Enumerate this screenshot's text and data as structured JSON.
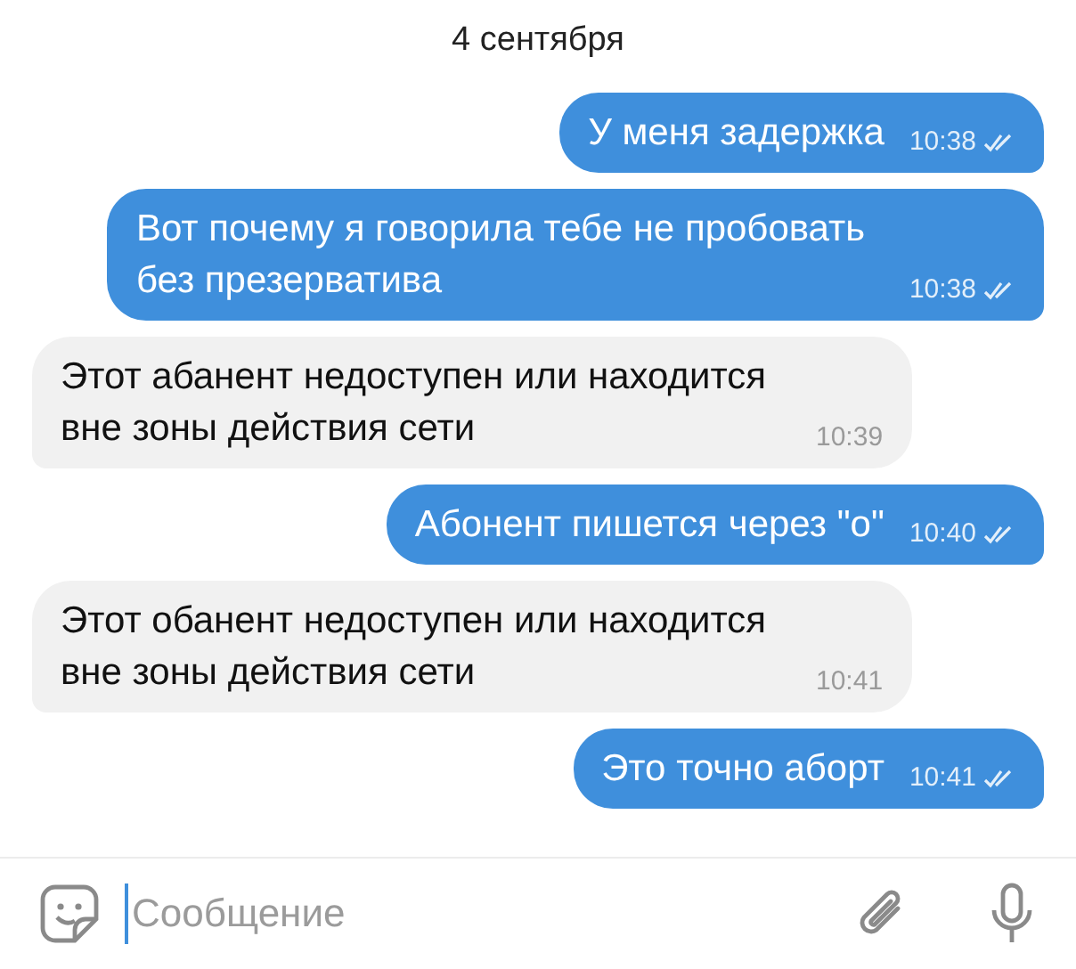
{
  "date": "4 сентября",
  "messages": [
    {
      "kind": "outgoing",
      "text": "У меня задержка",
      "time": "10:38",
      "read": true
    },
    {
      "kind": "outgoing",
      "text": "Вот почему я говорила тебе не пробовать без презерватива",
      "time": "10:38",
      "read": true
    },
    {
      "kind": "incoming",
      "text": "Этот абанент недоступен или находится вне зоны действия сети",
      "time": "10:39"
    },
    {
      "kind": "outgoing",
      "text": "Абонент пишется через \"о\"",
      "time": "10:40",
      "read": true
    },
    {
      "kind": "incoming",
      "text": "Этот обанент недоступен или находится вне зоны действия сети",
      "time": "10:41"
    },
    {
      "kind": "outgoing",
      "text": "Это точно аборт",
      "time": "10:41",
      "read": true
    }
  ],
  "composer": {
    "placeholder": "Сообщение"
  }
}
